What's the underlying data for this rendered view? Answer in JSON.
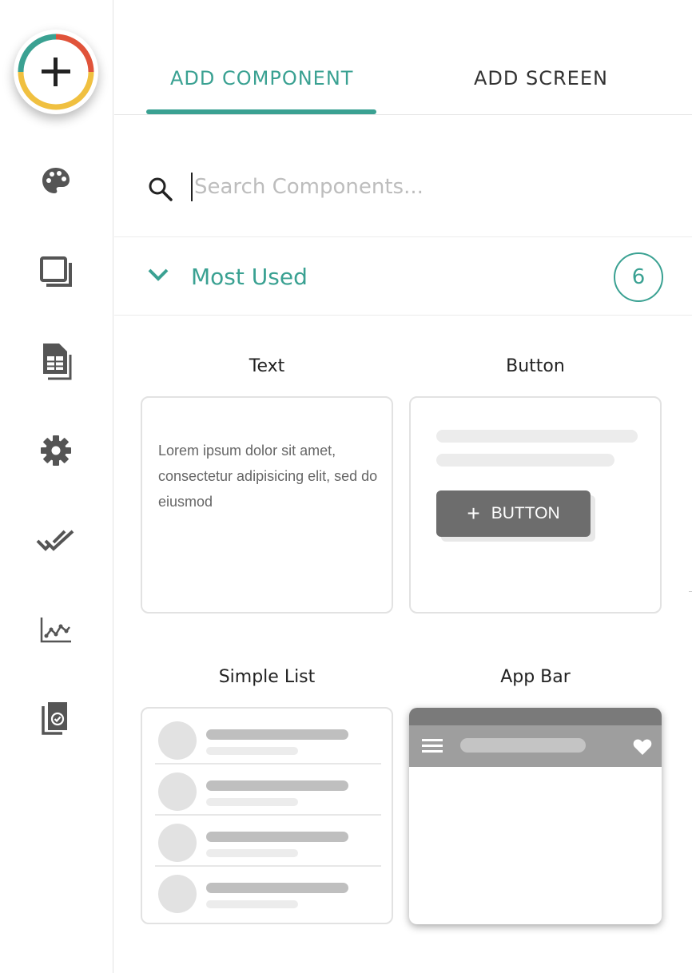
{
  "fab": {
    "icon": "plus-icon",
    "ring_colors": [
      "#3aa192",
      "#e0533a",
      "#f0c040"
    ]
  },
  "sidebar": {
    "items": [
      {
        "icon": "palette-icon"
      },
      {
        "icon": "screens-icon"
      },
      {
        "icon": "database-sheet-icon"
      },
      {
        "icon": "gear-icon"
      },
      {
        "icon": "double-check-icon"
      },
      {
        "icon": "analytics-chart-icon"
      },
      {
        "icon": "publish-copy-icon"
      }
    ]
  },
  "tabs": [
    {
      "label": "ADD COMPONENT",
      "active": true
    },
    {
      "label": "ADD SCREEN",
      "active": false
    }
  ],
  "search": {
    "placeholder": "Search Components...",
    "value": ""
  },
  "section": {
    "title": "Most Used",
    "count": "6",
    "expanded": true
  },
  "components": [
    {
      "label": "Text",
      "preview_text": "Lorem ipsum dolor sit amet, consectetur adipisicing elit, sed do eiusmod"
    },
    {
      "label": "Button",
      "preview_button_label": "BUTTON"
    },
    {
      "label": "Simple List"
    },
    {
      "label": "App Bar"
    }
  ],
  "colors": {
    "accent": "#3aa192",
    "icon": "#555555"
  }
}
